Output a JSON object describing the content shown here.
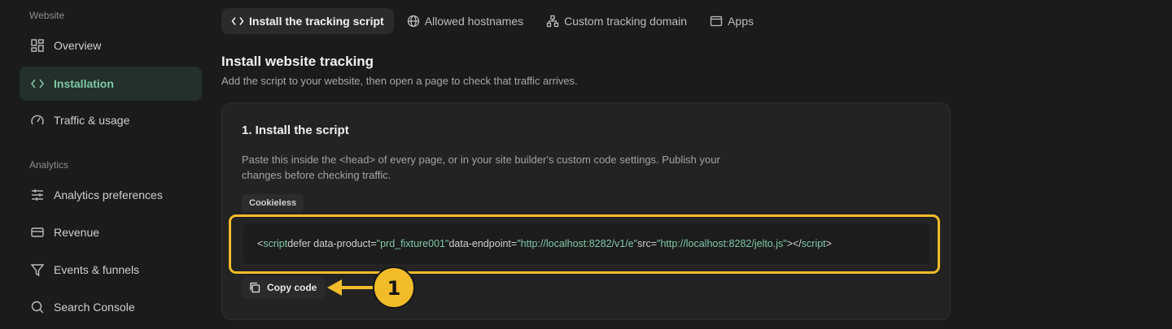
{
  "sidebar": {
    "sections": [
      {
        "label": "Website"
      },
      {
        "label": "Analytics"
      }
    ],
    "items": [
      {
        "label": "Overview",
        "icon": "layout-grid-icon"
      },
      {
        "label": "Installation",
        "icon": "code-icon",
        "active": true
      },
      {
        "label": "Traffic & usage",
        "icon": "gauge-icon"
      },
      {
        "label": "Analytics preferences",
        "icon": "sliders-icon"
      },
      {
        "label": "Revenue",
        "icon": "credit-card-icon"
      },
      {
        "label": "Events & funnels",
        "icon": "funnel-icon"
      },
      {
        "label": "Search Console",
        "icon": "search-icon"
      }
    ]
  },
  "tabs": [
    {
      "label": "Install the tracking script",
      "icon": "code-icon",
      "active": true
    },
    {
      "label": "Allowed hostnames",
      "icon": "globe-icon"
    },
    {
      "label": "Custom tracking domain",
      "icon": "network-icon"
    },
    {
      "label": "Apps",
      "icon": "app-window-icon"
    }
  ],
  "main": {
    "title": "Install website tracking",
    "subtitle": "Add the script to your website, then open a page to check that traffic arrives."
  },
  "card": {
    "title": "1. Install the script",
    "description": "Paste this inside the <head> of every page, or in your site builder's custom code settings. Publish your changes before checking traffic.",
    "badge": "Cookieless",
    "code": {
      "open_lt": "<",
      "tag": "script",
      "attr1": " defer data-product=",
      "val1": "\"prd_fixture001\"",
      "attr2": " data-endpoint=",
      "val2": "\"http://localhost:8282/v1/e\"",
      "attr3": " src=",
      "val3": "\"http://localhost:8282/jelto.js\"",
      "close_mid": "></",
      "close_tag": "script",
      "close_gt": ">"
    },
    "copy_label": "Copy code"
  },
  "annotation": {
    "number": "1",
    "highlight_color": "#f1bb2a"
  },
  "colors": {
    "accent": "#7fc9a6",
    "background": "#1b1b1b",
    "card": "#232323",
    "highlight": "#f1bb2a"
  }
}
